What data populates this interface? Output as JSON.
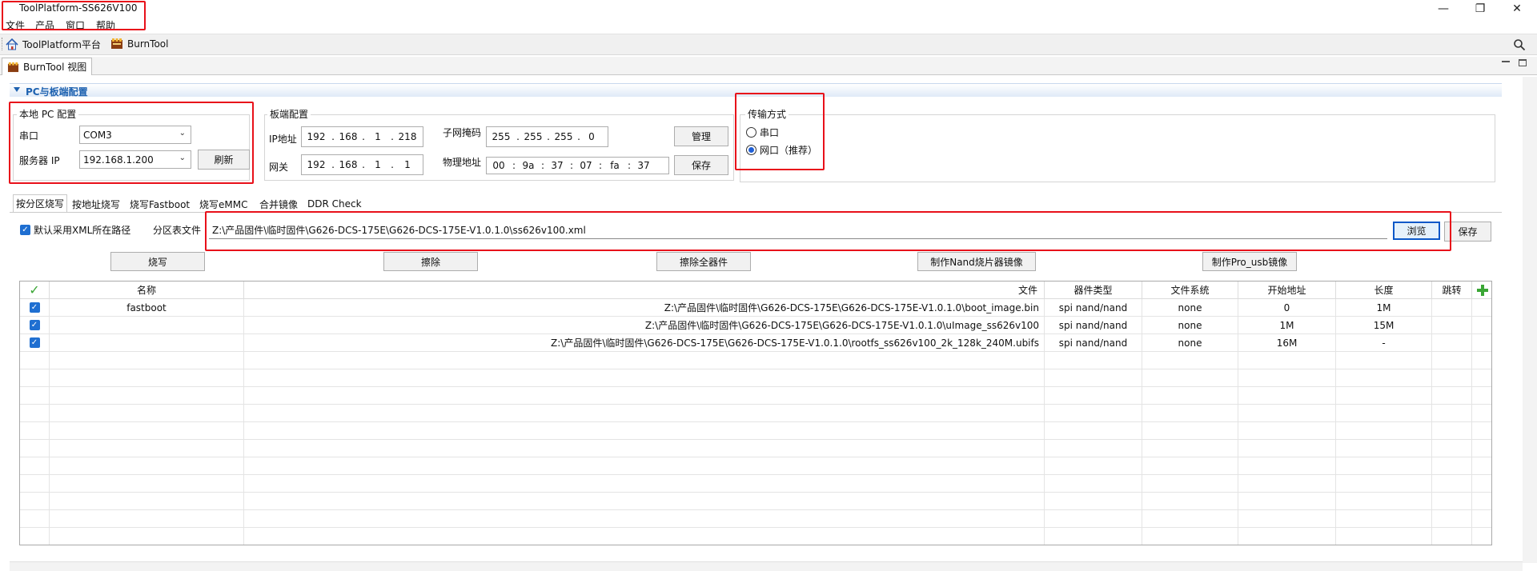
{
  "window": {
    "title": "ToolPlatform-SS626V100",
    "minimize": "—",
    "restore": "❐",
    "close": "✕"
  },
  "menu": [
    "文件",
    "产品",
    "窗口",
    "帮助"
  ],
  "toolbar": {
    "platform_label": "ToolPlatform平台",
    "burntool_label": "BurnTool"
  },
  "view_tab": {
    "label": "BurnTool 视图"
  },
  "section": {
    "title": "PC与板端配置"
  },
  "local_pc": {
    "title": "本地 PC 配置",
    "serial_label": "串口",
    "serial_value": "COM3",
    "server_ip_label": "服务器 IP",
    "server_ip_value": "192.168.1.200",
    "refresh_button": "刷新"
  },
  "board": {
    "title": "板端配置",
    "ip_label": "IP地址",
    "ip": [
      "192",
      "168",
      "1",
      "218"
    ],
    "gateway_label": "网关",
    "gateway": [
      "192",
      "168",
      "1",
      "1"
    ],
    "mask_label": "子网掩码",
    "mask": [
      "255",
      "255",
      "255",
      "0"
    ],
    "mac_label": "物理地址",
    "mac": [
      "00",
      "9a",
      "37",
      "07",
      "fa",
      "37"
    ],
    "manage_button": "管理",
    "save_button": "保存"
  },
  "transfer": {
    "title": "传输方式",
    "options": [
      {
        "label": "串口",
        "selected": false
      },
      {
        "label": "网口（推荐）",
        "selected": true
      }
    ]
  },
  "tabs": [
    "按分区烧写",
    "按地址烧写",
    "烧写Fastboot",
    "烧写eMMC",
    "合并镜像",
    "DDR Check"
  ],
  "active_tab": 0,
  "xml": {
    "use_xml_path_label": "默认采用XML所在路径",
    "use_xml_path_checked": true,
    "partition_file_label": "分区表文件",
    "path": "Z:\\产品固件\\临时固件\\G626-DCS-175E\\G626-DCS-175E-V1.0.1.0\\ss626v100.xml",
    "browse_button": "浏览",
    "save_button": "保存"
  },
  "actions": [
    "烧写",
    "擦除",
    "擦除全器件",
    "制作Nand烧片器镜像",
    "制作Pro_usb镜像"
  ],
  "table": {
    "columns": [
      "",
      "名称",
      "文件",
      "器件类型",
      "文件系统",
      "开始地址",
      "长度",
      "跳转",
      ""
    ],
    "rows": [
      {
        "checked": true,
        "name": "fastboot",
        "file": "Z:\\产品固件\\临时固件\\G626-DCS-175E\\G626-DCS-175E-V1.0.1.0\\boot_image.bin",
        "device": "spi nand/nand",
        "fs": "none",
        "start": "0",
        "length": "1M",
        "jump": ""
      },
      {
        "checked": true,
        "name": "",
        "file": "Z:\\产品固件\\临时固件\\G626-DCS-175E\\G626-DCS-175E-V1.0.1.0\\uImage_ss626v100",
        "device": "spi nand/nand",
        "fs": "none",
        "start": "1M",
        "length": "15M",
        "jump": ""
      },
      {
        "checked": true,
        "name": "",
        "file": "Z:\\产品固件\\临时固件\\G626-DCS-175E\\G626-DCS-175E-V1.0.1.0\\rootfs_ss626v100_2k_128k_240M.ubifs",
        "device": "spi nand/nand",
        "fs": "none",
        "start": "16M",
        "length": "-",
        "jump": ""
      }
    ]
  },
  "colors": {
    "highlight": "#e8101a",
    "accent": "#1e62b0",
    "check": "#1f6fd1"
  }
}
